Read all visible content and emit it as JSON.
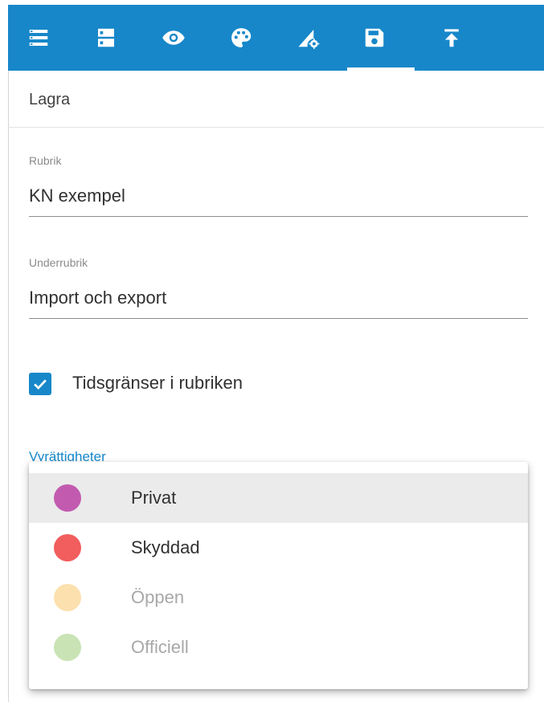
{
  "toolbar": {
    "icons": [
      "list-icon",
      "storage-icon",
      "eye-icon",
      "palette-icon",
      "signal-settings-icon",
      "save-icon",
      "upload-icon"
    ],
    "active": "save-icon",
    "background": "#1787c9"
  },
  "panel": {
    "title": "Lagra"
  },
  "form": {
    "title_field": {
      "label": "Rubrik",
      "value": "KN exempel"
    },
    "subtitle_field": {
      "label": "Underrubrik",
      "value": "Import och export"
    },
    "time_limits_checkbox": {
      "label": "Tidsgränser i rubriken",
      "checked": true
    },
    "permissions_label": "Vyrättigheter"
  },
  "permissions_menu": {
    "highlighted": "Privat",
    "items": [
      {
        "label": "Privat",
        "color": "#c25bb0",
        "enabled": true
      },
      {
        "label": "Skyddad",
        "color": "#f25d5d",
        "enabled": true
      },
      {
        "label": "Öppen",
        "color": "#fce0ad",
        "enabled": false
      },
      {
        "label": "Officiell",
        "color": "#c9e3b5",
        "enabled": false
      }
    ]
  }
}
